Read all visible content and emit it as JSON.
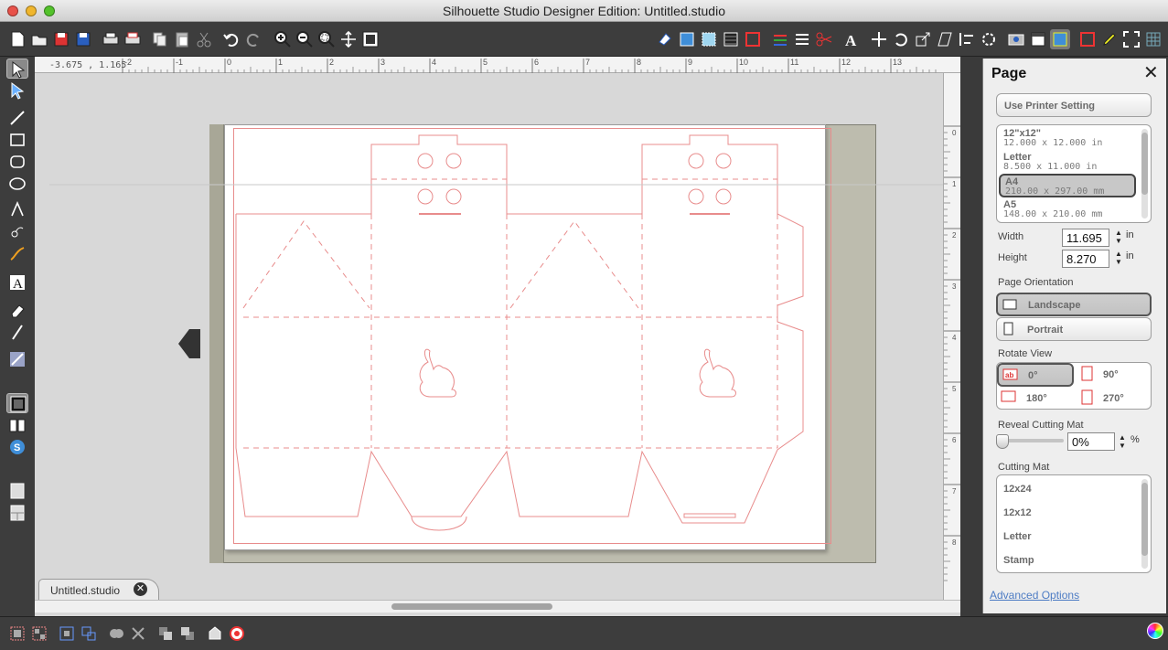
{
  "window": {
    "title": "Silhouette Studio Designer Edition: Untitled.studio"
  },
  "canvas": {
    "coordinates": "-3.675 , 1.165",
    "ruler_top": [
      "-2",
      "-1",
      "0",
      "1",
      "2",
      "3",
      "4",
      "5",
      "6",
      "7",
      "8",
      "9",
      "10",
      "11",
      "12",
      "13"
    ],
    "ruler_right": [
      "0",
      "1",
      "2",
      "3",
      "4",
      "5",
      "6",
      "7",
      "8"
    ]
  },
  "tabs": [
    {
      "label": "Untitled.studio",
      "close": "✕"
    }
  ],
  "panel": {
    "title": "Page",
    "close": "✕",
    "use_printer": "Use Printer Setting",
    "page_sizes": [
      {
        "name": "12\"x12\"",
        "dims": "12.000 x 12.000 in"
      },
      {
        "name": "Letter",
        "dims": "8.500 x 11.000 in"
      },
      {
        "name": "A4",
        "dims": "210.00 x 297.00 mm",
        "selected": true
      },
      {
        "name": "A5",
        "dims": "148.00 x 210.00 mm"
      }
    ],
    "width_label": "Width",
    "width_value": "11.695",
    "height_label": "Height",
    "height_value": "8.270",
    "unit": "in",
    "orientation_label": "Page Orientation",
    "landscape": "Landscape",
    "portrait": "Portrait",
    "rotate_label": "Rotate View",
    "rot0": "0°",
    "rot90": "90°",
    "rot180": "180°",
    "rot270": "270°",
    "reveal_label": "Reveal Cutting Mat",
    "reveal_value": "0%",
    "reveal_fraction": 0,
    "percent": "%",
    "mat_label": "Cutting Mat",
    "mats": [
      "12x24",
      "12x12",
      "Letter",
      "Stamp"
    ],
    "advanced": "Advanced Options"
  },
  "colors": {
    "cut_line": "#e88c8c",
    "toolbar": "#3d3d3d",
    "mat": "#bdbcae",
    "link": "#4d7cc4"
  }
}
